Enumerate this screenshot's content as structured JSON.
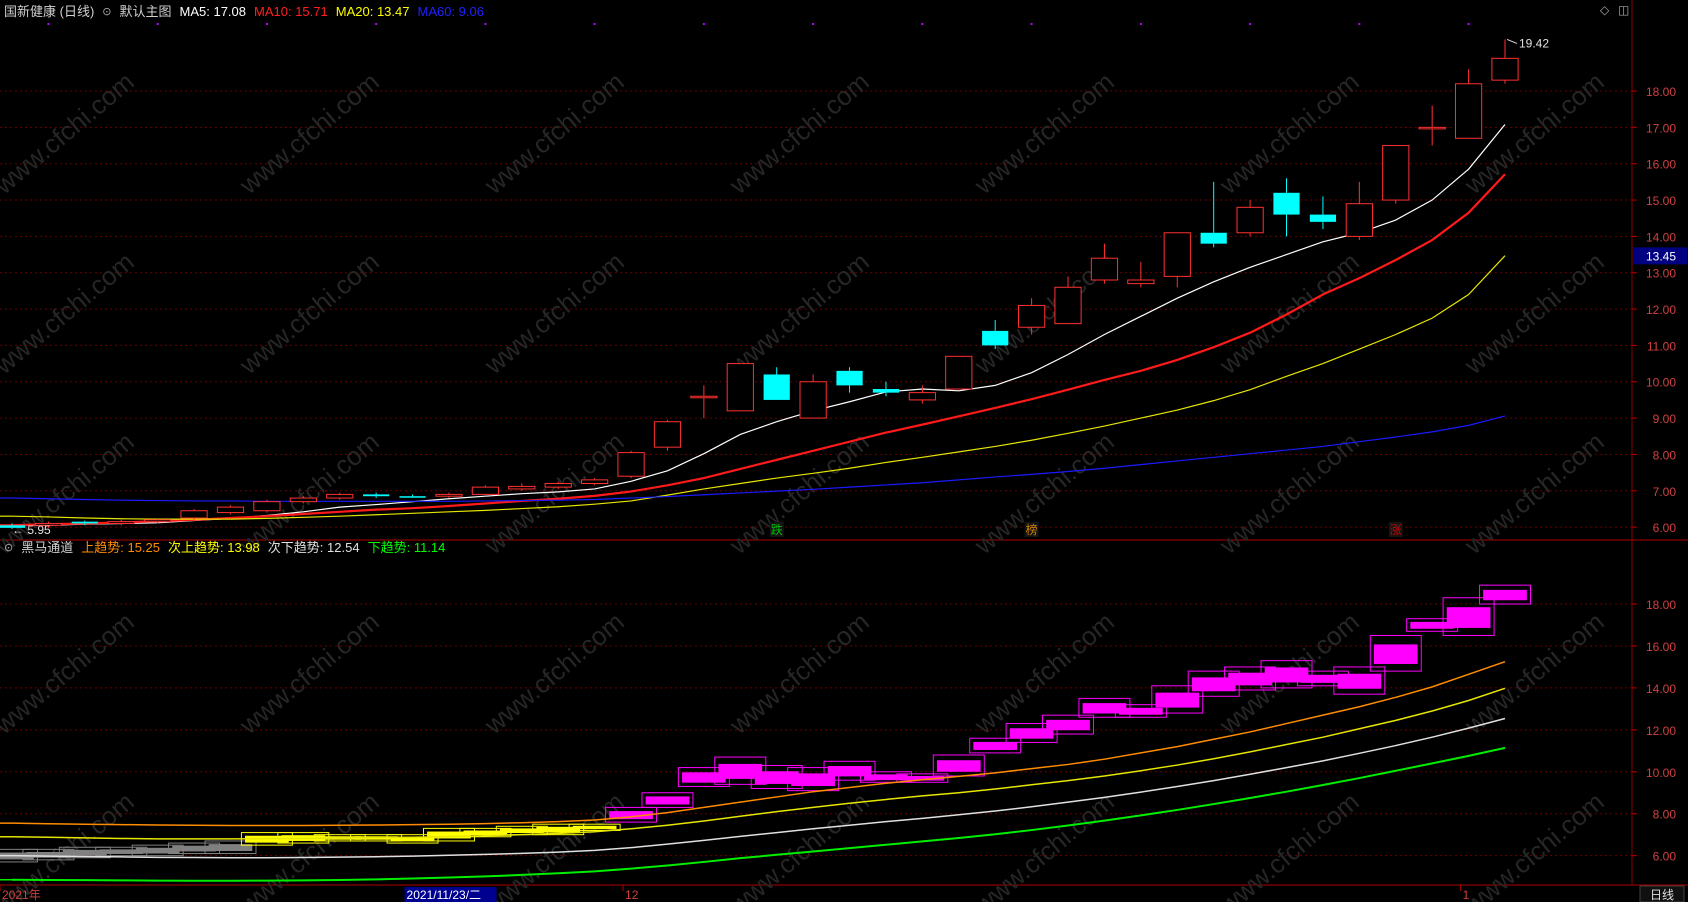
{
  "panel_top": {
    "stock_name": "国新健康 (日线)",
    "chart_mode": "默认主图",
    "indicators": [
      {
        "label": "MA5:",
        "value": "17.08",
        "color": "#ffffff"
      },
      {
        "label": "MA10:",
        "value": "15.71",
        "color": "#ff2020"
      },
      {
        "label": "MA20:",
        "value": "13.47",
        "color": "#ffff00"
      },
      {
        "label": "MA60:",
        "value": "9.06",
        "color": "#2020ff"
      }
    ],
    "high_label": "19.42",
    "low_label": "5.95",
    "current_price_tag": "13.45",
    "event_markers": [
      {
        "label": "跌",
        "index": 21
      },
      {
        "label": "榜",
        "index": 28
      },
      {
        "label": "涨",
        "index": 38
      }
    ]
  },
  "panel_bottom": {
    "indicator_name": "黑马通道",
    "indicators": [
      {
        "label": "上趋势:",
        "value": "15.25",
        "color": "#ff8c00"
      },
      {
        "label": "次上趋势:",
        "value": "13.98",
        "color": "#ffff00"
      },
      {
        "label": "次下趋势:",
        "value": "12.54",
        "color": "#e0e0e0"
      },
      {
        "label": "下趋势:",
        "value": "11.14",
        "color": "#00ff00"
      }
    ]
  },
  "x_axis": {
    "labels": [
      {
        "text": "2021年",
        "index": 0
      },
      {
        "text": "2021/11/23/二",
        "index": 11,
        "highlight": true
      },
      {
        "text": "12",
        "index": 17
      },
      {
        "text": "1",
        "index": 40
      }
    ],
    "period_button": "日线"
  },
  "watermark": "www.cfchi.com",
  "colors": {
    "up": "#ff3030",
    "down": "#00ffff",
    "grid": "#6a0000",
    "ma5": "#ffffff",
    "ma10": "#ff1a1a",
    "ma20": "#e6e600",
    "ma60": "#1a1aff",
    "channel_box": "#ff00ff",
    "channel_early_yellow": "#ffff00",
    "channel_early_gray": "#808080"
  },
  "chart_data": [
    {
      "type": "candlestick",
      "title": "国新健康 (日线)",
      "ylim": [
        5.7,
        19.9
      ],
      "yticks": [
        6,
        7,
        8,
        9,
        10,
        11,
        12,
        13,
        14,
        15,
        16,
        17,
        18
      ],
      "ohlc": [
        [
          6.05,
          6.1,
          5.95,
          5.98
        ],
        [
          6.05,
          6.15,
          5.98,
          6.1
        ],
        [
          6.15,
          6.18,
          6.05,
          6.1
        ],
        [
          6.1,
          6.2,
          6.05,
          6.15
        ],
        [
          6.15,
          6.25,
          6.1,
          6.2
        ],
        [
          6.25,
          6.5,
          6.2,
          6.45
        ],
        [
          6.4,
          6.6,
          6.35,
          6.55
        ],
        [
          6.45,
          6.75,
          6.4,
          6.7
        ],
        [
          6.7,
          6.85,
          6.65,
          6.8
        ],
        [
          6.8,
          6.95,
          6.75,
          6.9
        ],
        [
          6.9,
          6.95,
          6.8,
          6.85
        ],
        [
          6.85,
          6.9,
          6.8,
          6.82
        ],
        [
          6.85,
          6.95,
          6.8,
          6.9
        ],
        [
          6.9,
          7.15,
          6.85,
          7.1
        ],
        [
          7.05,
          7.2,
          7.0,
          7.12
        ],
        [
          7.1,
          7.25,
          7.05,
          7.2
        ],
        [
          7.2,
          7.35,
          7.15,
          7.3
        ],
        [
          7.4,
          8.1,
          7.35,
          8.05
        ],
        [
          8.2,
          8.95,
          8.1,
          8.9
        ],
        [
          9.6,
          9.9,
          9.0,
          9.6
        ],
        [
          9.2,
          10.5,
          9.2,
          10.5
        ],
        [
          10.2,
          10.4,
          9.5,
          9.5
        ],
        [
          9.0,
          10.2,
          9.0,
          10.0
        ],
        [
          10.3,
          10.4,
          9.7,
          9.9
        ],
        [
          9.8,
          10.0,
          9.6,
          9.7
        ],
        [
          9.5,
          9.9,
          9.4,
          9.7
        ],
        [
          9.8,
          10.7,
          9.8,
          10.7
        ],
        [
          11.4,
          11.7,
          10.9,
          11.0
        ],
        [
          11.5,
          12.3,
          11.3,
          12.1
        ],
        [
          11.6,
          12.9,
          11.6,
          12.6
        ],
        [
          12.8,
          13.8,
          12.7,
          13.4
        ],
        [
          12.7,
          13.3,
          12.6,
          12.8
        ],
        [
          12.9,
          14.1,
          12.6,
          14.1
        ],
        [
          14.1,
          15.5,
          13.7,
          13.8
        ],
        [
          14.1,
          15.0,
          14.0,
          14.8
        ],
        [
          15.2,
          15.6,
          14.0,
          14.6
        ],
        [
          14.6,
          15.1,
          14.2,
          14.4
        ],
        [
          14.0,
          15.5,
          13.9,
          14.9
        ],
        [
          15.0,
          16.5,
          14.9,
          16.5
        ],
        [
          17.0,
          17.6,
          16.5,
          17.0
        ],
        [
          16.7,
          18.6,
          16.7,
          18.2
        ],
        [
          18.3,
          19.42,
          18.2,
          18.9
        ]
      ],
      "series": [
        {
          "name": "MA5",
          "values": [
            6.05,
            6.05,
            6.08,
            6.1,
            6.12,
            6.18,
            6.24,
            6.32,
            6.42,
            6.55,
            6.62,
            6.7,
            6.78,
            6.85,
            6.92,
            6.97,
            7.05,
            7.26,
            7.55,
            8.02,
            8.55,
            8.9,
            9.2,
            9.45,
            9.72,
            9.8,
            9.75,
            9.9,
            10.25,
            10.75,
            11.3,
            11.8,
            12.3,
            12.75,
            13.15,
            13.5,
            13.85,
            14.1,
            14.45,
            15.0,
            15.85,
            17.08
          ]
        },
        {
          "name": "MA10",
          "values": [
            6.05,
            6.08,
            6.1,
            6.13,
            6.16,
            6.2,
            6.25,
            6.3,
            6.36,
            6.42,
            6.48,
            6.52,
            6.58,
            6.65,
            6.72,
            6.78,
            6.86,
            6.98,
            7.15,
            7.35,
            7.6,
            7.85,
            8.1,
            8.35,
            8.6,
            8.82,
            9.05,
            9.28,
            9.52,
            9.78,
            10.05,
            10.3,
            10.6,
            10.95,
            11.35,
            11.85,
            12.4,
            12.85,
            13.35,
            13.9,
            14.65,
            15.71
          ]
        },
        {
          "name": "MA20",
          "values": [
            6.3,
            6.28,
            6.25,
            6.23,
            6.22,
            6.22,
            6.22,
            6.24,
            6.27,
            6.3,
            6.34,
            6.38,
            6.42,
            6.46,
            6.51,
            6.56,
            6.63,
            6.72,
            6.88,
            7.05,
            7.2,
            7.35,
            7.48,
            7.62,
            7.78,
            7.92,
            8.07,
            8.22,
            8.39,
            8.58,
            8.78,
            9.0,
            9.22,
            9.48,
            9.78,
            10.15,
            10.5,
            10.9,
            11.3,
            11.75,
            12.4,
            13.47
          ]
        },
        {
          "name": "MA60",
          "values": [
            6.8,
            6.78,
            6.76,
            6.74,
            6.73,
            6.72,
            6.72,
            6.71,
            6.71,
            6.71,
            6.71,
            6.71,
            6.71,
            6.72,
            6.73,
            6.74,
            6.76,
            6.8,
            6.84,
            6.89,
            6.94,
            6.99,
            7.04,
            7.1,
            7.16,
            7.22,
            7.3,
            7.38,
            7.45,
            7.53,
            7.62,
            7.72,
            7.82,
            7.92,
            8.02,
            8.12,
            8.22,
            8.35,
            8.48,
            8.62,
            8.8,
            9.06
          ]
        }
      ]
    },
    {
      "type": "line",
      "title": "黑马通道",
      "ylim": [
        4.6,
        20.1
      ],
      "yticks": [
        6,
        8,
        10,
        12,
        14,
        16,
        18
      ],
      "series": [
        {
          "name": "上趋势",
          "values": [
            7.55,
            7.52,
            7.5,
            7.48,
            7.46,
            7.45,
            7.44,
            7.44,
            7.44,
            7.45,
            7.46,
            7.48,
            7.5,
            7.53,
            7.57,
            7.62,
            7.7,
            7.85,
            8.05,
            8.3,
            8.55,
            8.8,
            9.05,
            9.25,
            9.45,
            9.62,
            9.78,
            9.95,
            10.15,
            10.35,
            10.6,
            10.9,
            11.2,
            11.55,
            11.9,
            12.3,
            12.7,
            13.1,
            13.55,
            14.05,
            14.65,
            15.25
          ]
        },
        {
          "name": "次上趋势",
          "values": [
            6.9,
            6.88,
            6.85,
            6.82,
            6.8,
            6.8,
            6.8,
            6.81,
            6.82,
            6.84,
            6.86,
            6.88,
            6.91,
            6.95,
            7.0,
            7.06,
            7.14,
            7.28,
            7.45,
            7.65,
            7.88,
            8.1,
            8.3,
            8.5,
            8.68,
            8.85,
            9.0,
            9.18,
            9.38,
            9.58,
            9.8,
            10.05,
            10.32,
            10.62,
            10.95,
            11.3,
            11.65,
            12.05,
            12.45,
            12.9,
            13.4,
            13.98
          ]
        },
        {
          "name": "次下趋势",
          "values": [
            6.0,
            5.98,
            5.96,
            5.94,
            5.92,
            5.91,
            5.9,
            5.9,
            5.91,
            5.93,
            5.95,
            5.98,
            6.02,
            6.06,
            6.11,
            6.17,
            6.25,
            6.38,
            6.55,
            6.73,
            6.92,
            7.1,
            7.28,
            7.45,
            7.62,
            7.78,
            7.95,
            8.13,
            8.33,
            8.55,
            8.78,
            9.03,
            9.3,
            9.58,
            9.88,
            10.2,
            10.52,
            10.88,
            11.25,
            11.65,
            12.08,
            12.54
          ]
        },
        {
          "name": "下趋势",
          "values": [
            4.85,
            4.84,
            4.83,
            4.82,
            4.81,
            4.8,
            4.8,
            4.81,
            4.82,
            4.84,
            4.87,
            4.91,
            4.96,
            5.01,
            5.08,
            5.16,
            5.25,
            5.38,
            5.53,
            5.7,
            5.88,
            6.04,
            6.2,
            6.36,
            6.52,
            6.68,
            6.84,
            7.02,
            7.22,
            7.44,
            7.67,
            7.92,
            8.18,
            8.46,
            8.75,
            9.05,
            9.37,
            9.7,
            10.05,
            10.4,
            10.76,
            11.14
          ]
        }
      ],
      "boxes": [
        [
          5.7,
          6.3
        ],
        [
          5.8,
          6.3
        ],
        [
          5.9,
          6.4
        ],
        [
          6.0,
          6.4
        ],
        [
          6.0,
          6.5
        ],
        [
          6.1,
          6.6
        ],
        [
          6.1,
          6.7
        ],
        [
          6.5,
          7.1
        ],
        [
          6.6,
          7.1
        ],
        [
          6.7,
          7.0
        ],
        [
          6.7,
          7.0
        ],
        [
          6.6,
          7.0
        ],
        [
          6.7,
          7.3
        ],
        [
          6.9,
          7.3
        ],
        [
          7.0,
          7.4
        ],
        [
          7.0,
          7.5
        ],
        [
          7.2,
          7.5
        ],
        [
          7.6,
          8.3
        ],
        [
          8.3,
          9.0
        ],
        [
          9.3,
          10.2
        ],
        [
          9.4,
          10.7
        ],
        [
          9.2,
          10.3
        ],
        [
          9.1,
          10.2
        ],
        [
          9.6,
          10.5
        ],
        [
          9.5,
          10.0
        ],
        [
          9.5,
          9.9
        ],
        [
          9.8,
          10.8
        ],
        [
          10.9,
          11.6
        ],
        [
          11.4,
          12.3
        ],
        [
          11.8,
          12.7
        ],
        [
          12.6,
          13.5
        ],
        [
          12.6,
          13.2
        ],
        [
          12.8,
          14.1
        ],
        [
          13.6,
          14.8
        ],
        [
          13.9,
          15.0
        ],
        [
          14.0,
          15.3
        ],
        [
          14.1,
          14.8
        ],
        [
          13.7,
          15.0
        ],
        [
          14.8,
          16.5
        ],
        [
          16.7,
          17.3
        ],
        [
          16.5,
          18.3
        ],
        [
          18.0,
          18.9
        ]
      ],
      "box_colors": [
        "gray",
        "gray",
        "gray",
        "gray",
        "gray",
        "gray",
        "gray",
        "yellow",
        "yellow",
        "yellow",
        "yellow",
        "yellow",
        "yellow",
        "yellow",
        "yellow",
        "yellow",
        "yellow",
        "magenta",
        "magenta",
        "magenta",
        "magenta",
        "magenta",
        "magenta",
        "magenta",
        "magenta",
        "magenta",
        "magenta",
        "magenta",
        "magenta",
        "magenta",
        "magenta",
        "magenta",
        "magenta",
        "magenta",
        "magenta",
        "magenta",
        "magenta",
        "magenta",
        "magenta",
        "magenta",
        "magenta",
        "magenta"
      ]
    }
  ]
}
